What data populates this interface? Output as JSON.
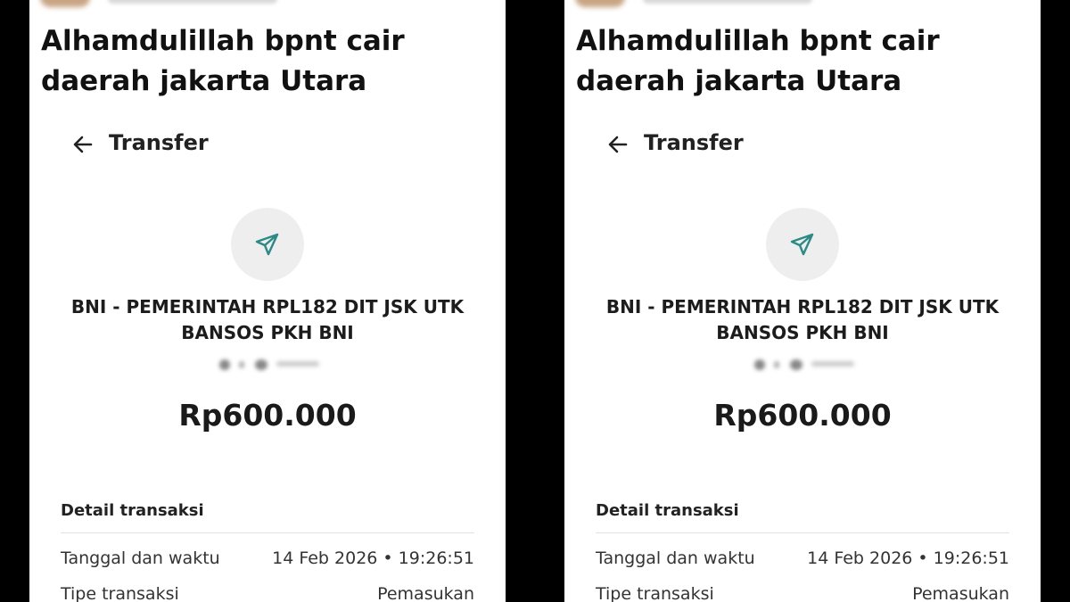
{
  "post_title": "Alhamdulillah bpnt cair daerah jakarta Utara",
  "screen": {
    "title": "Transfer",
    "back_icon": "arrow-left-icon",
    "transfer_icon": "paper-plane-icon"
  },
  "transaction": {
    "recipient": "BNI - PEMERINTAH RPL182 DIT JSK UTK BANSOS PKH BNI",
    "amount": "Rp600.000"
  },
  "details": {
    "section_title": "Detail transaksi",
    "rows": [
      {
        "label": "Tanggal dan waktu",
        "value": "14 Feb 2026 • 19:26:51"
      },
      {
        "label": "Tipe transaksi",
        "value": "Pemasukan"
      }
    ]
  },
  "colors": {
    "background": "#000000",
    "card": "#ffffff",
    "icon_circle": "#eeeeee",
    "icon_accent": "#2a8a86"
  }
}
